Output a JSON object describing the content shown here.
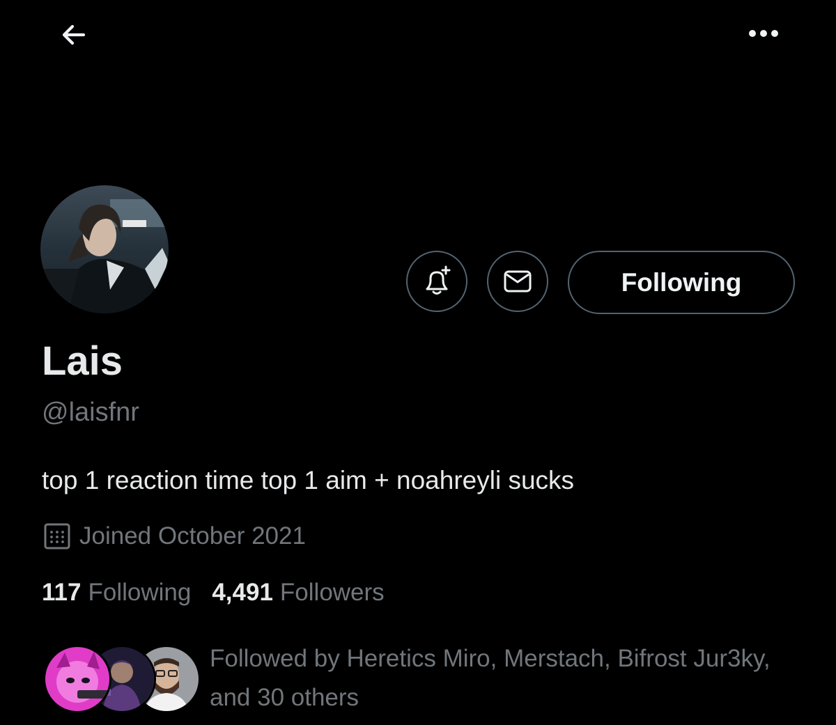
{
  "header": {
    "back_icon": "arrow-left-icon",
    "more_icon": "more-horizontal-icon"
  },
  "profile": {
    "display_name": "Lais",
    "handle": "@laisfnr",
    "bio": "top 1 reaction time top 1 aim + noahreyli sucks",
    "joined_icon": "calendar-icon",
    "joined": "Joined October 2021",
    "following_count": "117",
    "following_label": "Following",
    "followers_count": "4,491",
    "followers_label": "Followers"
  },
  "actions": {
    "notify_icon": "bell-plus-icon",
    "message_icon": "envelope-icon",
    "following_button_label": "Following"
  },
  "followed_by": {
    "text": "Followed by Heretics Miro, Merstach, Bifrost Jur3ky, and 30 others"
  },
  "colors": {
    "background": "#000000",
    "primary_text": "#e7e9ea",
    "secondary_text": "#71767b",
    "button_border": "#536471"
  }
}
